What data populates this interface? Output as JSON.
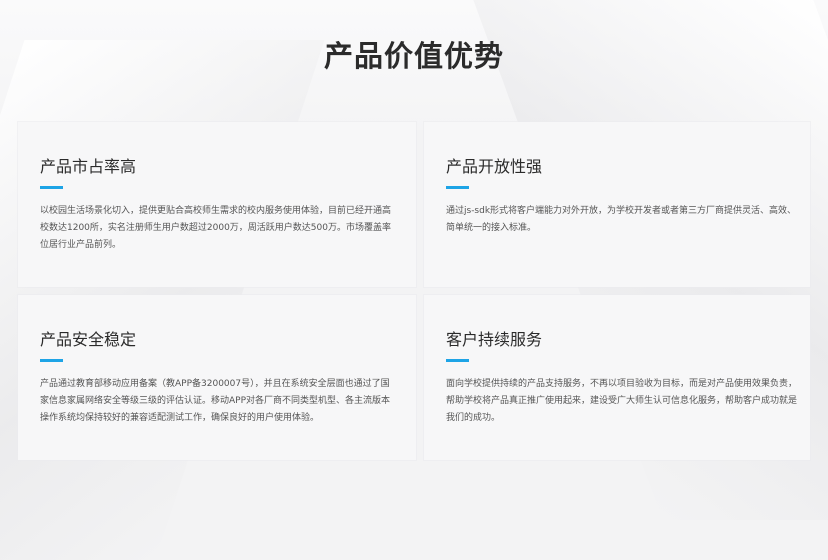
{
  "page": {
    "title": "产品价值优势"
  },
  "theme": {
    "accent": "#1ea4e6",
    "card_bg": "#f7f7f8",
    "page_bg": "#f3f3f4"
  },
  "cards": [
    {
      "title": "产品市占率高",
      "text": "以校园生活场景化切入，提供更贴合高校师生需求的校内服务使用体验，目前已经开通高校数达1200所，实名注册师生用户数超过2000万，周活跃用户数达500万。市场覆盖率位居行业产品前列。"
    },
    {
      "title": "产品开放性强",
      "text": "通过js-sdk形式将客户端能力对外开放，为学校开发者或者第三方厂商提供灵活、高效、简单统一的接入标准。"
    },
    {
      "title": "产品安全稳定",
      "text": "产品通过教育部移动应用备案（教APP备3200007号），并且在系统安全层面也通过了国家信息家属网络安全等级三级的评估认证。移动APP对各厂商不同类型机型、各主流版本操作系统均保持较好的兼容适配测试工作，确保良好的用户使用体验。"
    },
    {
      "title": "客户持续服务",
      "text": "面向学校提供持续的产品支持服务，不再以项目验收为目标，而是对产品使用效果负责，帮助学校将产品真正推广使用起来，建设受广大师生认可信息化服务，帮助客户成功就是我们的成功。"
    }
  ]
}
